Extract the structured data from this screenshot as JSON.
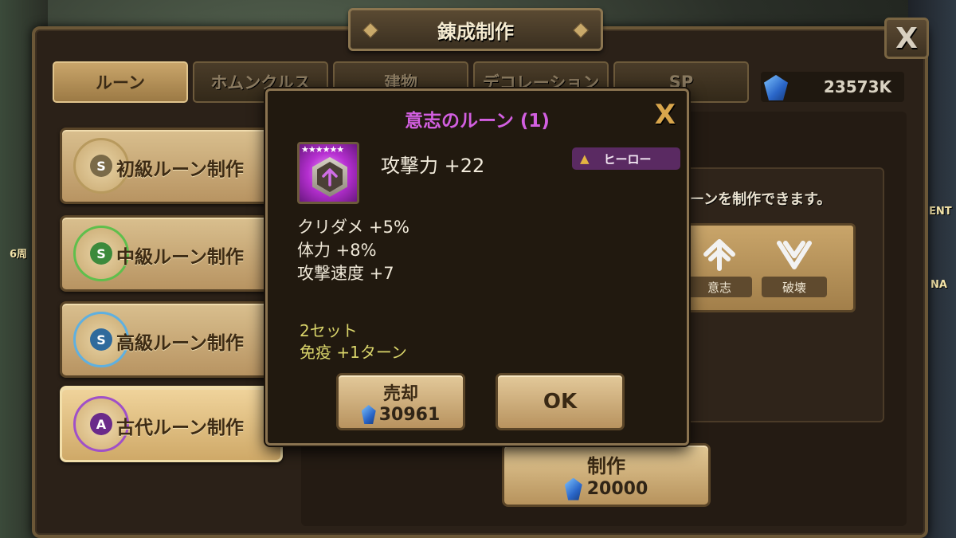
{
  "window": {
    "title": "錬成制作",
    "close_label": "X"
  },
  "tabs": [
    {
      "label": "ルーン",
      "active": true
    },
    {
      "label": "ホムンクルス",
      "active": false
    },
    {
      "label": "建物",
      "active": false
    },
    {
      "label": "デコレーション",
      "active": false
    },
    {
      "label": "SP",
      "active": false
    }
  ],
  "currency": {
    "icon": "crystal-icon",
    "value": "23573K"
  },
  "rune_categories": [
    {
      "label": "初級ルーン制作",
      "core_color": "#7a6a48",
      "ring_color": "#b89a5e",
      "selected": false
    },
    {
      "label": "中級ルーン制作",
      "core_color": "#3c8a3c",
      "ring_color": "#5fbf4c",
      "selected": false
    },
    {
      "label": "高級ルーン制作",
      "core_color": "#2f6a9c",
      "ring_color": "#5fb0e0",
      "selected": false
    },
    {
      "label": "古代ルーン制作",
      "core_color": "#6a2a8a",
      "ring_color": "#a050c8",
      "selected": true
    }
  ],
  "info": {
    "description": "ーンを制作できます。",
    "sets": [
      {
        "name": "意志",
        "icon": "will-rune-icon"
      },
      {
        "name": "破壊",
        "icon": "destroy-rune-icon"
      }
    ],
    "craft": {
      "label": "制作",
      "cost": "20000"
    }
  },
  "side": {
    "left_text": "6周",
    "right_text": "ENT",
    "right_text2": "NA"
  },
  "popup": {
    "title": "意志のルーン (1)",
    "close_label": "X",
    "stars": "★★★★★★",
    "main_stat": "攻撃力 +22",
    "grade": "ヒーロー",
    "grade_color": "#5a2a62",
    "sub_stats": [
      "クリダメ +5%",
      "体力 +8%",
      "攻撃速度 +7"
    ],
    "set_effect": [
      "2セット",
      "免疫 +1ターン"
    ],
    "sell_label": "売却",
    "sell_price": "30961",
    "ok_label": "OK"
  },
  "colors": {
    "title_magenta": "#d25fe0",
    "set_effect_yellow": "#d9d46a",
    "frame_brown": "#6b5737"
  }
}
